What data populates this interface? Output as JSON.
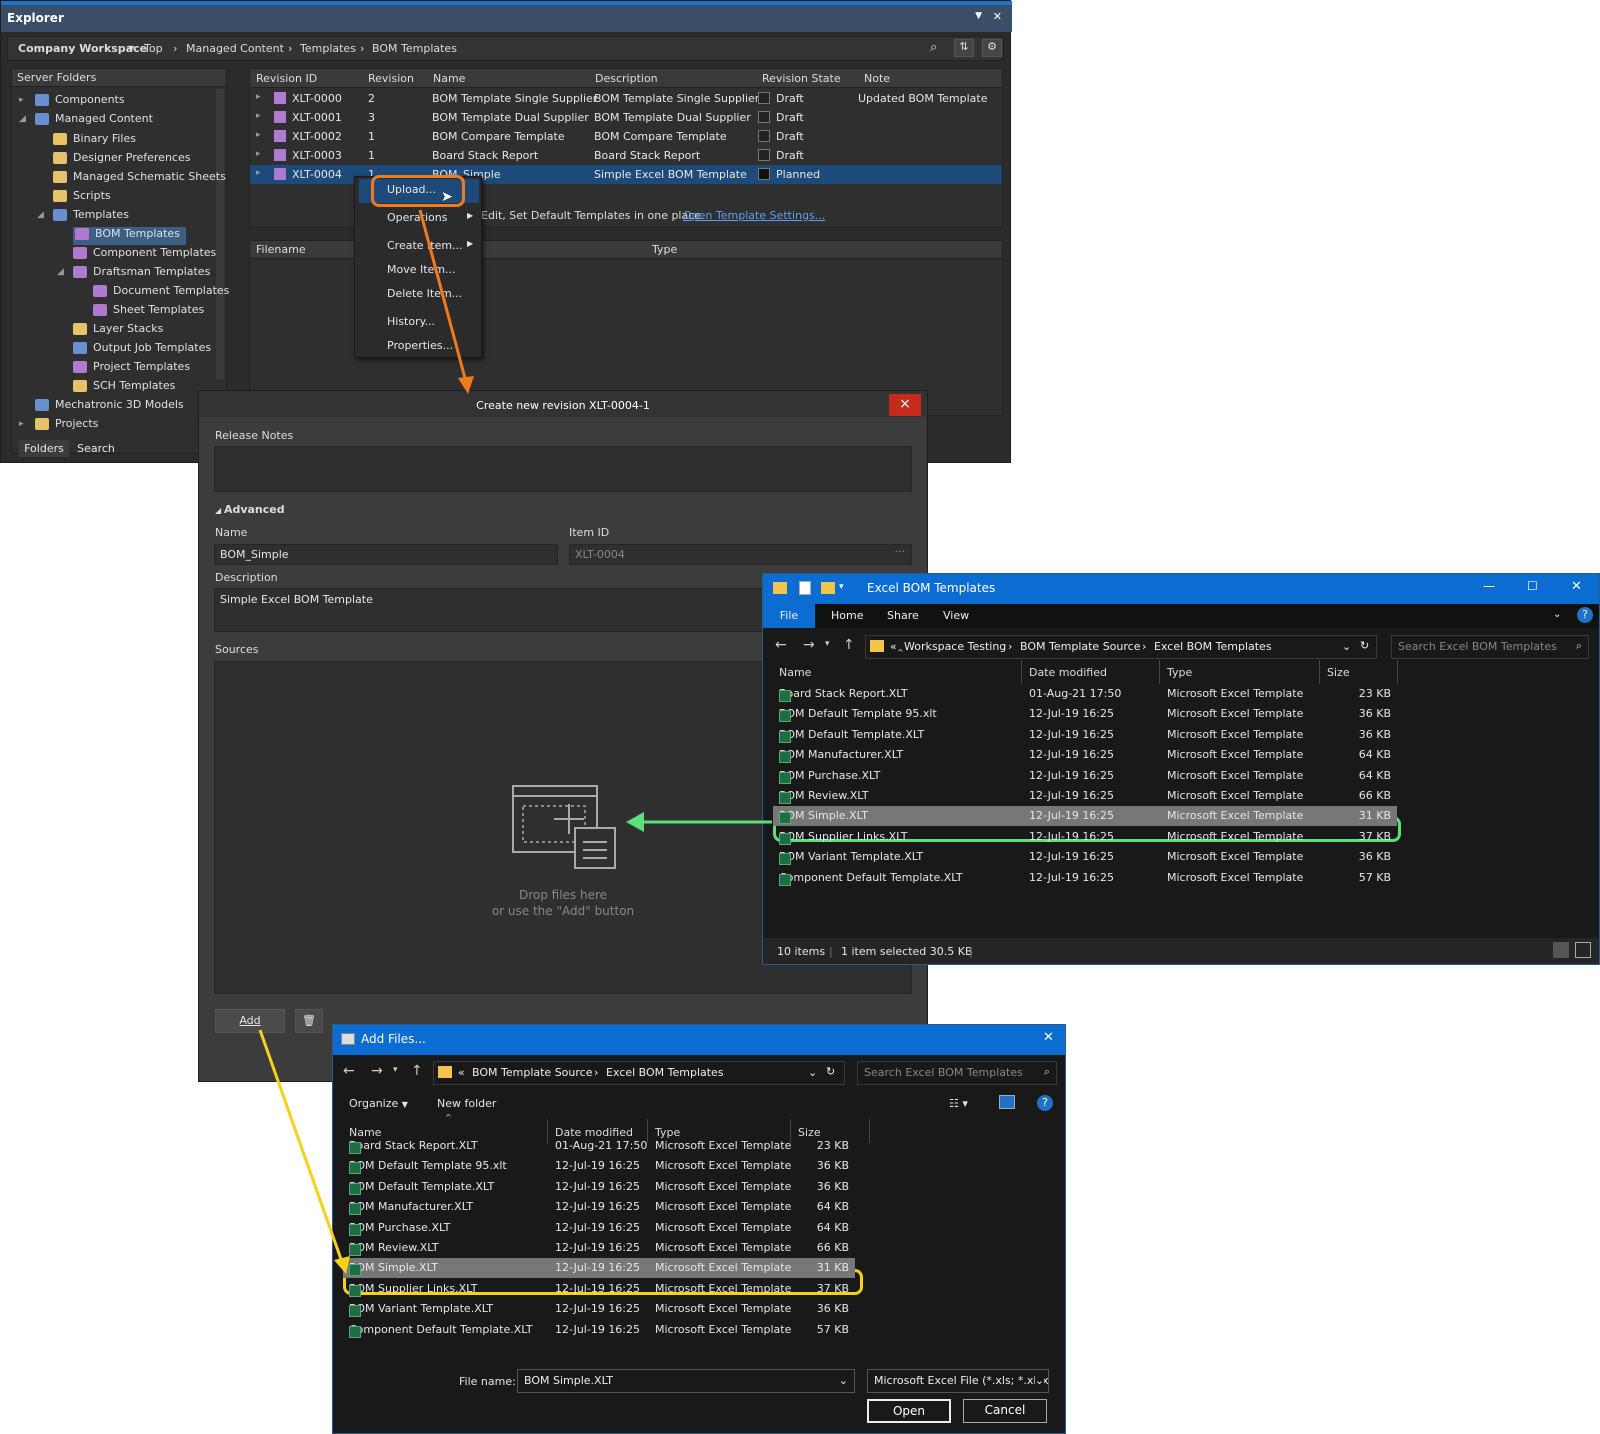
{
  "explorer": {
    "title": "Explorer",
    "breadcrumb": [
      "Company Workspace",
      "Top",
      "Managed Content",
      "Templates",
      "BOM Templates"
    ],
    "server_folders_header": "Server Folders",
    "tree": [
      "Components",
      "Managed Content",
      "Binary Files",
      "Designer Preferences",
      "Managed Schematic Sheets",
      "Scripts",
      "Templates",
      "BOM Templates",
      "Component Templates",
      "Draftsman Templates",
      "Document Templates",
      "Sheet Templates",
      "Layer Stacks",
      "Output Job Templates",
      "Project Templates",
      "SCH Templates",
      "Mechatronic 3D Models",
      "Projects"
    ],
    "tabs": [
      "Folders",
      "Search"
    ],
    "columns": [
      "Revision ID",
      "Revision",
      "Name",
      "Description",
      "Revision State",
      "Note"
    ],
    "rows": [
      {
        "id": "XLT-0000",
        "rev": "2",
        "name": "BOM Template Single Supplier",
        "desc": "BOM Template Single Supplier",
        "state": "Draft",
        "note": "Updated BOM Template"
      },
      {
        "id": "XLT-0001",
        "rev": "3",
        "name": "BOM Template Dual Supplier",
        "desc": "BOM Template Dual Supplier",
        "state": "Draft",
        "note": ""
      },
      {
        "id": "XLT-0002",
        "rev": "1",
        "name": "BOM Compare Template",
        "desc": "BOM Compare Template",
        "state": "Draft",
        "note": ""
      },
      {
        "id": "XLT-0003",
        "rev": "1",
        "name": "Board Stack Report",
        "desc": "Board Stack Report",
        "state": "Draft",
        "note": ""
      },
      {
        "id": "XLT-0004",
        "rev": "1",
        "name": "BOM_Simple",
        "desc": "Simple Excel BOM Template",
        "state": "Planned",
        "note": ""
      }
    ],
    "info_text": "Edit, Set Default Templates in one place.",
    "info_link": "Open Template Settings...",
    "lower_columns": [
      "Filename",
      "Type"
    ]
  },
  "context_menu": [
    "Upload...",
    "Operations",
    "Create Item...",
    "Move Item...",
    "Delete Item...",
    "History...",
    "Properties..."
  ],
  "create_dialog": {
    "title": "Create new revision XLT-0004-1",
    "close": "×",
    "release_notes": "Release Notes",
    "advanced": "Advanced",
    "name_label": "Name",
    "name_value": "BOM_Simple",
    "itemid_label": "Item ID",
    "itemid_value": "XLT-0004",
    "desc_label": "Description",
    "desc_value": "Simple Excel BOM Template",
    "sources_label": "Sources",
    "drop1": "Drop files here",
    "drop2": "or use the \"Add\" button",
    "add": "Add"
  },
  "win_explorer": {
    "title": "Excel BOM Templates",
    "ribbon": [
      "File",
      "Home",
      "Share",
      "View"
    ],
    "address": [
      "Workspace Testing",
      "BOM Template Source",
      "Excel BOM Templates"
    ],
    "search_placeholder": "Search Excel BOM Templates",
    "columns": [
      "Name",
      "Date modified",
      "Type",
      "Size"
    ],
    "status": "10 items",
    "status_sel": "1 item selected  30.5 KB"
  },
  "files": [
    {
      "name": "Board Stack Report.XLT",
      "date": "01-Aug-21 17:50",
      "type": "Microsoft Excel Template",
      "size": "23 KB"
    },
    {
      "name": "BOM Default Template 95.xlt",
      "date": "12-Jul-19 16:25",
      "type": "Microsoft Excel Template",
      "size": "36 KB"
    },
    {
      "name": "BOM Default Template.XLT",
      "date": "12-Jul-19 16:25",
      "type": "Microsoft Excel Template",
      "size": "36 KB"
    },
    {
      "name": "BOM Manufacturer.XLT",
      "date": "12-Jul-19 16:25",
      "type": "Microsoft Excel Template",
      "size": "64 KB"
    },
    {
      "name": "BOM Purchase.XLT",
      "date": "12-Jul-19 16:25",
      "type": "Microsoft Excel Template",
      "size": "64 KB"
    },
    {
      "name": "BOM Review.XLT",
      "date": "12-Jul-19 16:25",
      "type": "Microsoft Excel Template",
      "size": "66 KB"
    },
    {
      "name": "BOM Simple.XLT",
      "date": "12-Jul-19 16:25",
      "type": "Microsoft Excel Template",
      "size": "31 KB"
    },
    {
      "name": "BOM Supplier Links.XLT",
      "date": "12-Jul-19 16:25",
      "type": "Microsoft Excel Template",
      "size": "37 KB"
    },
    {
      "name": "BOM Variant Template.XLT",
      "date": "12-Jul-19 16:25",
      "type": "Microsoft Excel Template",
      "size": "36 KB"
    },
    {
      "name": "Component Default Template.XLT",
      "date": "12-Jul-19 16:25",
      "type": "Microsoft Excel Template",
      "size": "57 KB"
    }
  ],
  "add_files": {
    "title": "Add Files...",
    "address": [
      "BOM Template Source",
      "Excel BOM Templates"
    ],
    "search_placeholder": "Search Excel BOM Templates",
    "organize": "Organize",
    "new_folder": "New folder",
    "file_name_label": "File name:",
    "file_name_value": "BOM Simple.XLT",
    "filter": "Microsoft Excel File (*.xls; *.xlsx",
    "open": "Open",
    "cancel": "Cancel"
  },
  "colors": {
    "orange": "#f07a1e",
    "green": "#5be07a",
    "yellow": "#f5d11a",
    "selection": "#1e4a7a",
    "title_blue": "#0b6cd1"
  }
}
